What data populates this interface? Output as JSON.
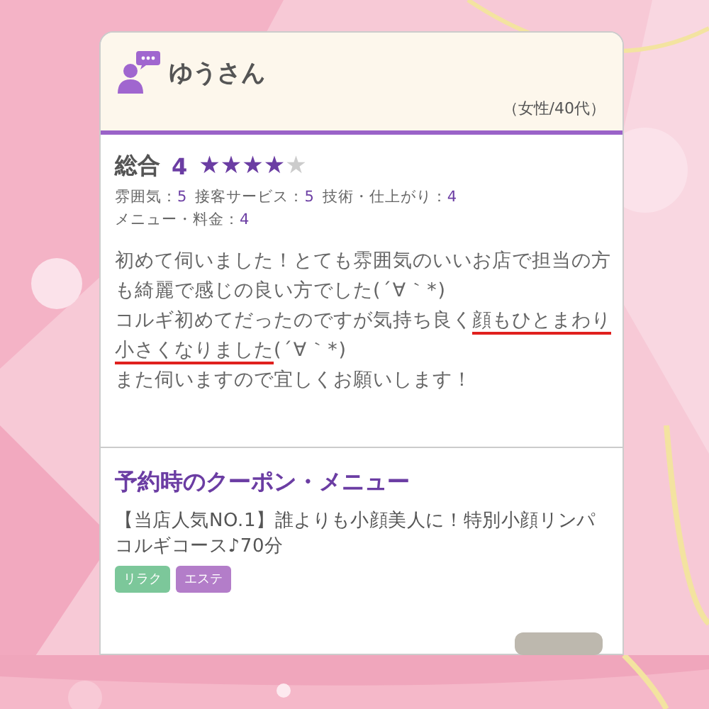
{
  "reviewer": {
    "name": "ゆうさん",
    "profile": "（女性/40代）"
  },
  "rating": {
    "label": "総合",
    "score": "4",
    "stars": 4,
    "details": [
      {
        "label": "雰囲気：",
        "value": "5"
      },
      {
        "label": "接客サービス：",
        "value": "5"
      },
      {
        "label": "技術・仕上がり：",
        "value": "4"
      },
      {
        "label": "メニュー・料金：",
        "value": "4"
      }
    ]
  },
  "comment": [
    {
      "text": "初めて伺いました！とても雰囲気のいいお店で担当の方も綺麗で感じの良い方でした(´∀｀*)\nコルギ初めてだったのですが気持ち良く",
      "underlined": false
    },
    {
      "text": "顔もひとまわり小さくなりました",
      "underlined": true
    },
    {
      "text": "(´∀｀*)\nまた伺いますので宜しくお願いします！",
      "underlined": false
    }
  ],
  "coupon": {
    "title": "予約時のクーポン・メニュー",
    "text": "【当店人気NO.1】誰よりも小顔美人に！特別小顔リンパコルギコース♪70分",
    "tags": [
      {
        "label": "リラク",
        "color": "#7cc79a"
      },
      {
        "label": "エステ",
        "color": "#b37dc9"
      }
    ]
  }
}
